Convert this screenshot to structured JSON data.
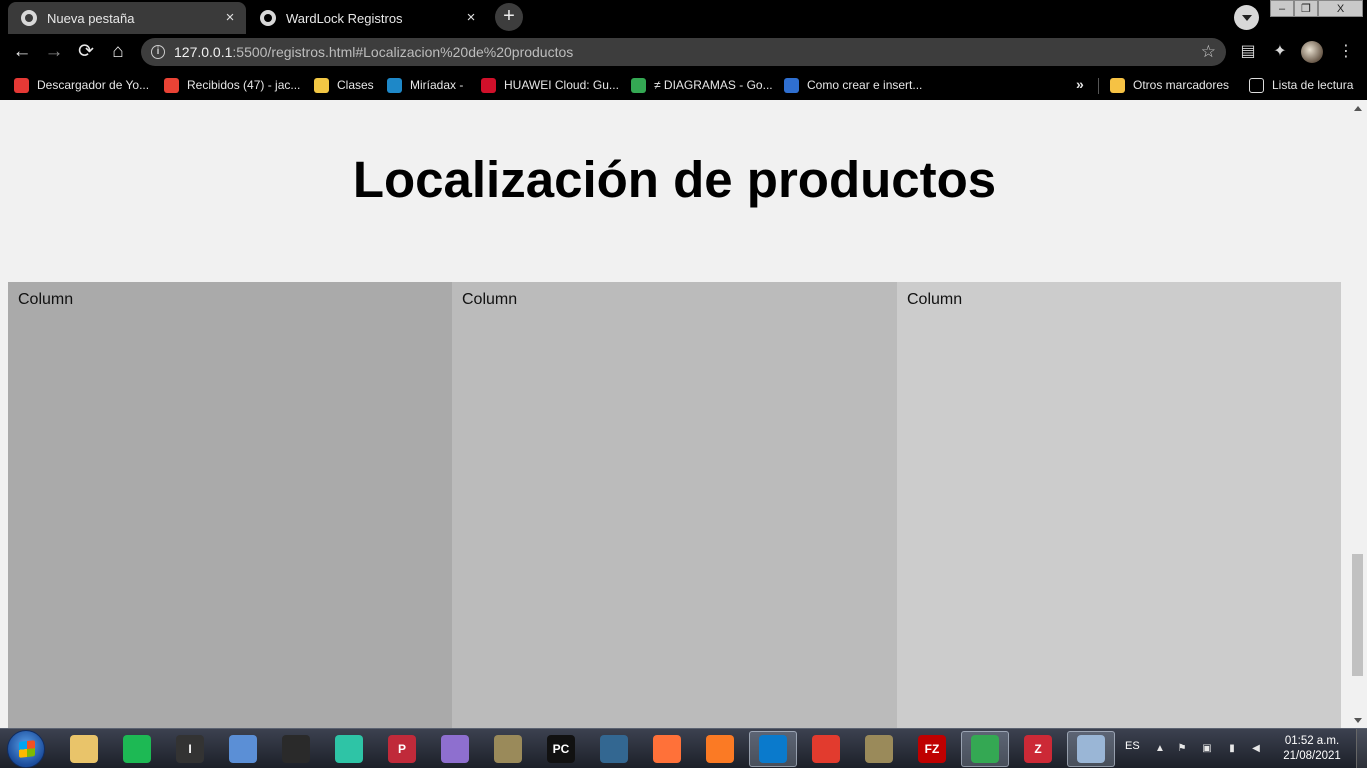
{
  "browser": {
    "tabs": [
      {
        "title": "Nueva pestaña",
        "active": false
      },
      {
        "title": "WardLock Registros",
        "active": true
      }
    ],
    "close_glyph": "×",
    "new_tab_glyph": "+",
    "window_controls": {
      "minimize": "–",
      "maximize": "❐",
      "close": "X"
    },
    "nav": {
      "back": "←",
      "forward": "→",
      "reload": "⟳",
      "home": "⌂"
    },
    "address": {
      "host": "127.0.0.1",
      "rest": ":5500/registros.html#Localizacion%20de%20productos"
    },
    "bookmark_star": "☆",
    "toolbar_icons": {
      "reading": "▤",
      "extensions": "✦",
      "menu": "⋮"
    }
  },
  "bookmarks": {
    "items": [
      {
        "label": "Descargador de Yo...",
        "icon_color": "#e53935"
      },
      {
        "label": "Recibidos (47) - jac...",
        "icon_color": "#ea4335"
      },
      {
        "label": "Clases",
        "icon_color": "#f2c744"
      },
      {
        "label": "Miríadax -",
        "icon_color": "#1e88c8"
      },
      {
        "label": "HUAWEI Cloud: Gu...",
        "icon_color": "#d0102a"
      },
      {
        "label": "≠ DIAGRAMAS - Go...",
        "icon_color": "#34a853"
      },
      {
        "label": "Como crear e insert...",
        "icon_color": "#2f6fd0"
      }
    ],
    "overflow": "»",
    "other": "Otros marcadores",
    "reading_list": "Lista de lectura"
  },
  "page": {
    "title": "Localización de productos",
    "columns": [
      "Column",
      "Column",
      "Column"
    ]
  },
  "taskbar": {
    "apps": [
      {
        "name": "file-explorer",
        "glyph": "",
        "color": "#e9c46a"
      },
      {
        "name": "spotify",
        "glyph": "",
        "color": "#1db954"
      },
      {
        "name": "app-i",
        "glyph": "I",
        "color": "#333333"
      },
      {
        "name": "virtualbox",
        "glyph": "",
        "color": "#5b8fd6"
      },
      {
        "name": "obs",
        "glyph": "",
        "color": "#2a2a2a"
      },
      {
        "name": "filmora",
        "glyph": "",
        "color": "#2ec4a6"
      },
      {
        "name": "app-p",
        "glyph": "P",
        "color": "#c02a3a"
      },
      {
        "name": "gem",
        "glyph": "",
        "color": "#8e6fcf"
      },
      {
        "name": "scanner",
        "glyph": "",
        "color": "#9a8a5a"
      },
      {
        "name": "pycharm",
        "glyph": "PC",
        "color": "#111111"
      },
      {
        "name": "postgresql",
        "glyph": "",
        "color": "#336791"
      },
      {
        "name": "firefox",
        "glyph": "",
        "color": "#ff7139"
      },
      {
        "name": "xampp",
        "glyph": "",
        "color": "#fb7a24"
      },
      {
        "name": "vscode",
        "glyph": "",
        "color": "#0a7acc"
      },
      {
        "name": "xmind",
        "glyph": "",
        "color": "#e23b2e"
      },
      {
        "name": "scanner-2",
        "glyph": "",
        "color": "#9a8a5a"
      },
      {
        "name": "filezilla",
        "glyph": "FZ",
        "color": "#bf0000"
      },
      {
        "name": "chrome",
        "glyph": "",
        "color": "#34a853"
      },
      {
        "name": "zotero",
        "glyph": "Z",
        "color": "#cc2936"
      },
      {
        "name": "paint",
        "glyph": "",
        "color": "#9ab6d6"
      }
    ],
    "language": "ES",
    "time": "01:52 a.m.",
    "date": "21/08/2021"
  }
}
